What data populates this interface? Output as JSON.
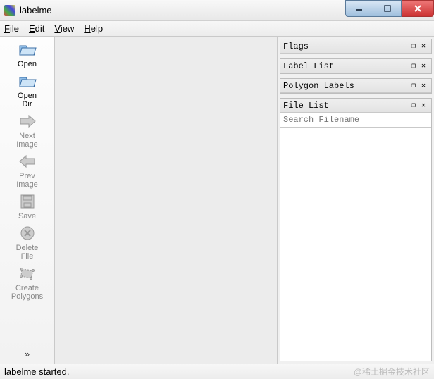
{
  "window": {
    "title": "labelme"
  },
  "menu": {
    "file": "File",
    "edit": "Edit",
    "view": "View",
    "help": "Help"
  },
  "toolbar": {
    "open": "Open",
    "open_dir": "Open\nDir",
    "next_image": "Next\nImage",
    "prev_image": "Prev\nImage",
    "save": "Save",
    "delete_file": "Delete\nFile",
    "create_polygons": "Create\nPolygons"
  },
  "panels": {
    "flags": {
      "title": "Flags"
    },
    "label_list": {
      "title": "Label List"
    },
    "polygon_labels": {
      "title": "Polygon Labels"
    },
    "file_list": {
      "title": "File List",
      "search_placeholder": "Search Filename"
    }
  },
  "status": {
    "text": "labelme started."
  },
  "watermark": "@稀土掘金技术社区"
}
